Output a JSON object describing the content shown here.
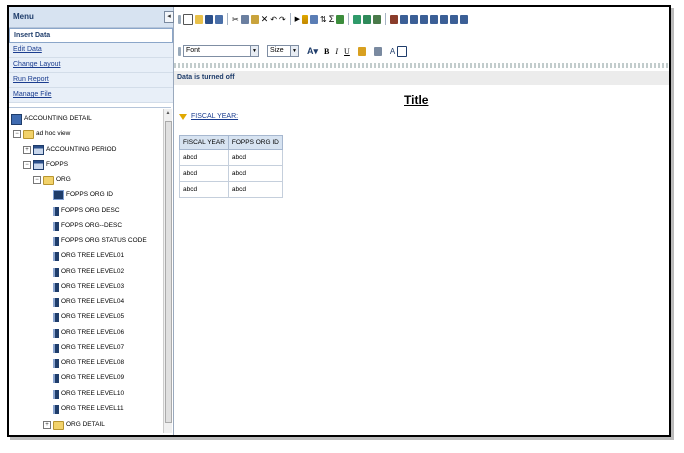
{
  "menu": {
    "header": "Menu",
    "items": [
      {
        "label": "Insert Data",
        "active": true
      },
      {
        "label": "Edit Data"
      },
      {
        "label": "Change Layout"
      },
      {
        "label": "Run Report"
      },
      {
        "label": "Manage File"
      }
    ]
  },
  "tree": {
    "root": "ACCOUNTING DETAIL",
    "view": "ad hoc view",
    "accounting_period": "ACCOUNTING PERIOD",
    "fopps": "FOPPS",
    "org": "ORG",
    "fields": [
      "FOPPS ORG ID",
      "FOPPS ORG DESC",
      "FOPPS ORG--DESC",
      "FOPPS ORG STATUS CODE",
      "ORG TREE LEVEL01",
      "ORG TREE LEVEL02",
      "ORG TREE LEVEL03",
      "ORG TREE LEVEL04",
      "ORG TREE LEVEL05",
      "ORG TREE LEVEL06",
      "ORG TREE LEVEL07",
      "ORG TREE LEVEL08",
      "ORG TREE LEVEL09",
      "ORG TREE LEVEL10",
      "ORG TREE LEVEL11"
    ],
    "org_detail": "ORG DETAIL"
  },
  "toolbar": {
    "font_select": "Font",
    "size_select": "Size",
    "bold": "B",
    "italic": "I",
    "underline": "U"
  },
  "status_text": "Data is turned off",
  "report": {
    "title": "Title",
    "filter_label": "FISCAL YEAR:",
    "columns": [
      "FISCAL YEAR",
      "FOPPS ORG ID"
    ],
    "rows": [
      [
        "abcd",
        "abcd"
      ],
      [
        "abcd",
        "abcd"
      ],
      [
        "abcd",
        "abcd"
      ]
    ]
  },
  "colors": {
    "accent": "#1f3d6b",
    "link": "#1a3c8f",
    "header_bg": "#d7e3f1"
  }
}
